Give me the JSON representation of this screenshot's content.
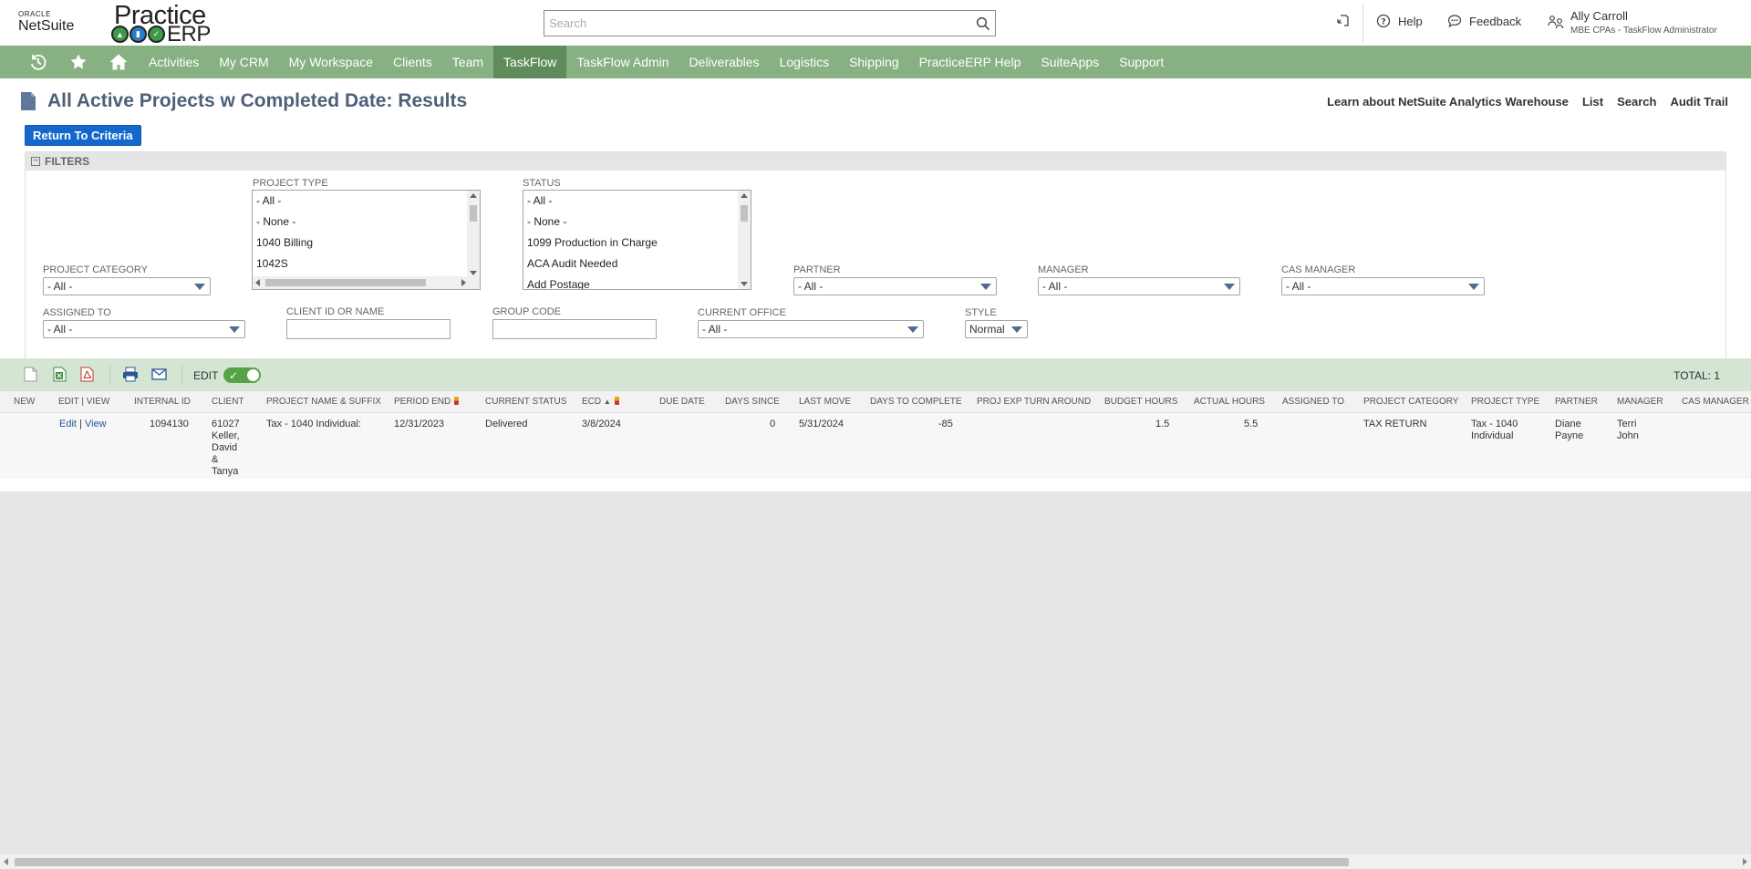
{
  "brand": {
    "oracle_line1": "ORACLE",
    "oracle_line2": "NetSuite",
    "practice": "Practice",
    "erp": "ERP"
  },
  "search": {
    "placeholder": "Search"
  },
  "header": {
    "help_label": "Help",
    "feedback_label": "Feedback",
    "user_name": "Ally Carroll",
    "user_role": "MBE CPAs - TaskFlow Administrator"
  },
  "nav": {
    "items": [
      {
        "label": "Activities"
      },
      {
        "label": "My CRM"
      },
      {
        "label": "My Workspace"
      },
      {
        "label": "Clients"
      },
      {
        "label": "Team"
      },
      {
        "label": "TaskFlow",
        "active": true
      },
      {
        "label": "TaskFlow Admin"
      },
      {
        "label": "Deliverables"
      },
      {
        "label": "Logistics"
      },
      {
        "label": "Shipping"
      },
      {
        "label": "PracticeERP Help"
      },
      {
        "label": "SuiteApps"
      },
      {
        "label": "Support"
      }
    ]
  },
  "page": {
    "title": "All Active Projects w Completed Date: Results",
    "links": [
      "Learn about NetSuite Analytics Warehouse",
      "List",
      "Search",
      "Audit Trail"
    ],
    "return_button": "Return To Criteria"
  },
  "filters": {
    "title": "FILTERS",
    "project_type": {
      "label": "PROJECT TYPE",
      "options": [
        "- All -",
        "- None -",
        "1040 Billing",
        "1042S"
      ]
    },
    "status": {
      "label": "STATUS",
      "options": [
        "- All -",
        "- None -",
        "1099 Production in Charge",
        "ACA Audit Needed",
        "Add Postage"
      ]
    },
    "project_category": {
      "label": "PROJECT CATEGORY",
      "value": "- All -"
    },
    "partner": {
      "label": "PARTNER",
      "value": "- All -"
    },
    "manager": {
      "label": "MANAGER",
      "value": "- All -"
    },
    "cas_manager": {
      "label": "CAS MANAGER",
      "value": "- All -"
    },
    "assigned_to": {
      "label": "ASSIGNED TO",
      "value": "- All -"
    },
    "client_id": {
      "label": "CLIENT ID OR NAME",
      "value": ""
    },
    "group_code": {
      "label": "GROUP CODE",
      "value": ""
    },
    "current_office": {
      "label": "CURRENT OFFICE",
      "value": "- All -"
    },
    "style": {
      "label": "STYLE",
      "value": "Normal"
    }
  },
  "toolbar": {
    "edit_label": "EDIT",
    "total": "TOTAL: 1"
  },
  "table": {
    "columns": {
      "new": "NEW",
      "edit_view": "EDIT | VIEW",
      "internal_id": "INTERNAL ID",
      "client": "CLIENT",
      "project_name": "PROJECT NAME & SUFFIX",
      "period_end": "PERIOD END",
      "current_status": "CURRENT STATUS",
      "ecd": "ECD",
      "due_date": "DUE DATE",
      "days_since": "DAYS SINCE",
      "last_move": "LAST MOVE",
      "days_to_complete": "DAYS TO COMPLETE",
      "proj_exp": "PROJ EXP TURN AROUND",
      "budget_hours": "BUDGET HOURS",
      "actual_hours": "ACTUAL HOURS",
      "assigned_to": "ASSIGNED TO",
      "project_category": "PROJECT CATEGORY",
      "project_type": "PROJECT TYPE",
      "partner": "PARTNER",
      "manager": "MANAGER",
      "cas_manager": "CAS MANAGER"
    },
    "ecd_sort_indicator": "▲",
    "row": {
      "edit": "Edit",
      "sep": "|",
      "view": "View",
      "internal_id": "1094130",
      "client_lines": [
        "61027",
        "Keller,",
        "David",
        "&",
        "Tanya"
      ],
      "project_name": "Tax - 1040 Individual:",
      "period_end": "12/31/2023",
      "current_status": "Delivered",
      "ecd": "3/8/2024",
      "due_date": "",
      "days_since": "0",
      "last_move": "5/31/2024",
      "days_to_complete": "-85",
      "proj_exp": "",
      "budget_hours": "1.5",
      "actual_hours": "5.5",
      "assigned_to": "",
      "project_category": "TAX RETURN",
      "project_type_lines": [
        "Tax - 1040",
        "Individual"
      ],
      "partner_lines": [
        "Diane",
        "Payne"
      ],
      "manager_lines": [
        "Terri",
        "John"
      ],
      "cas_manager": ""
    }
  },
  "colors": {
    "nav_bg": "#87b083",
    "nav_active": "#5f8c5b",
    "title": "#4d5f79",
    "button": "#1467cc",
    "toolbar_bg": "#d4e5d3",
    "toggle_on": "#57a147",
    "link": "#255599"
  }
}
